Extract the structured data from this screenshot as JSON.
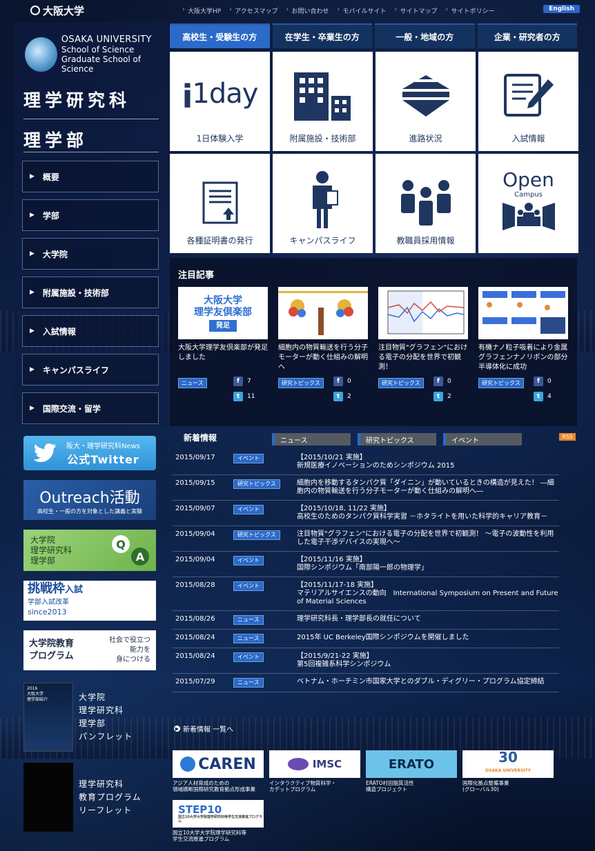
{
  "header": {
    "logo": "大阪大学",
    "links": [
      "大阪大学HP",
      "アクセスマップ",
      "お問い合わせ",
      "モバイルサイト",
      "サイトマップ",
      "サイトポリシー"
    ],
    "english": "English"
  },
  "sidebar": {
    "univ_name": "OSAKA UNIVERSITY",
    "school": "School of Science",
    "grad_school": "Graduate School of Science",
    "title1": "理学研究科",
    "title2": "理学部",
    "items": [
      "概要",
      "学部",
      "大学院",
      "附属施設・技術部",
      "入試情報",
      "キャンパスライフ",
      "国際交流・留学"
    ]
  },
  "categories": [
    "高校生・受験生の方",
    "在学生・卒業生の方",
    "一般・地域の方",
    "企業・研究者の方"
  ],
  "tiles": [
    {
      "label": "1日体験入学",
      "icon": "1day-icon",
      "text": "1day"
    },
    {
      "label": "附属施設・技術部",
      "icon": "building-icon"
    },
    {
      "label": "進路状況",
      "icon": "direction-icon"
    },
    {
      "label": "入試情報",
      "icon": "document-pen-icon"
    },
    {
      "label": "各種証明書の発行",
      "icon": "certificate-upload-icon"
    },
    {
      "label": "キャンパスライフ",
      "icon": "student-icon"
    },
    {
      "label": "教職員採用情報",
      "icon": "people-icon"
    },
    {
      "label": "",
      "icon": "open-campus-icon",
      "text": "Open",
      "sub": "Campus"
    }
  ],
  "featured": {
    "title": "注目記事",
    "items": [
      {
        "title": "大阪大学理学友倶楽部が発足しました",
        "tag": "ニュース",
        "fb": "7",
        "tw": "11",
        "img_text": "大阪大学\n理学友倶楽部",
        "img_sub": "発足"
      },
      {
        "title": "細胞内の物質輸送を行う分子モーターが動く仕組みの解明へ",
        "tag": "研究トピックス",
        "fb": "0",
        "tw": "2"
      },
      {
        "title": "注目物質\"グラフェン\"における電子の分配を世界で初観測！",
        "tag": "研究トピックス",
        "fb": "0",
        "tw": "2"
      },
      {
        "title": "有機ナノ粒子吸着により金属グラフェンナノリボンの部分半導体化に成功",
        "tag": "研究トピックス",
        "fb": "0",
        "tw": "4"
      }
    ]
  },
  "banners": {
    "twitter_top": "阪大・理学研究科News",
    "twitter_main": "公式Twitter",
    "outreach": "Outreach活動",
    "outreach_sub": "高校生・一般の方を対象とした講義と実験",
    "qa_l1": "大学院",
    "qa_l2": "理学研究科",
    "qa_l3": "理学部",
    "qa_q": "Q",
    "qa_a": "A",
    "challenge_main": "挑戦枠",
    "challenge_sub": "入試",
    "challenge_l2": "学部入試改革",
    "challenge_l3": "since2013",
    "gradedu_l1": "大学院教育",
    "gradedu_l2": "プログラム",
    "gradedu_r1": "社会で役立つ",
    "gradedu_r2": "能力を",
    "gradedu_r3": "身につける",
    "pamph_lines": [
      "大学院",
      "理学研究科",
      "理学部",
      "パンフレット"
    ],
    "pamph_cover": "2016\n大阪大学\n理学部紹介",
    "leaf_lines": [
      "理学研究科",
      "教育プログラム",
      "リーフレット"
    ]
  },
  "news": {
    "title": "新着情報",
    "tabs": [
      "ニュース",
      "研究トピックス",
      "イベント"
    ],
    "rss": "RSS",
    "rows": [
      {
        "date": "2015/09/17",
        "cat": "イベント",
        "text": "【2015/10/21 実施】\n新規医療イノベーションのためシンポジウム 2015"
      },
      {
        "date": "2015/09/15",
        "cat": "研究トピックス",
        "text": "細胞内を移動するタンパク質「ダイニン」が動いているときの構造が見えた！ ―細胞内の物質輸送を行う分子モーターが動く仕組みの解明へ―"
      },
      {
        "date": "2015/09/07",
        "cat": "イベント",
        "text": "【2015/10/18, 11/22 実施】\n高校生のためのタンパク質科学実習 －ホタライトを用いた科学的キャリア教育－"
      },
      {
        "date": "2015/09/04",
        "cat": "研究トピックス",
        "text": "注目物質\"グラフェン\"における電子の分配を世界で初観測！ ～電子の波動性を利用した電子干渉デバイスの実現へ～"
      },
      {
        "date": "2015/09/04",
        "cat": "イベント",
        "text": "【2015/11/16 実施】\n国際シンポジウム「南部陽一郎の物理学」"
      },
      {
        "date": "2015/08/28",
        "cat": "イベント",
        "text": "【2015/11/17-18 実施】\nマテリアルサイエンスの動向　International Symposium on Present and Future of Material Sciences"
      },
      {
        "date": "2015/08/26",
        "cat": "ニュース",
        "text": "理学研究科長・理学部長の就任について"
      },
      {
        "date": "2015/08/24",
        "cat": "ニュース",
        "text": "2015年 UC Berkeley国際シンポジウムを開催しました"
      },
      {
        "date": "2015/08/24",
        "cat": "イベント",
        "text": "【2015/9/21-22 実施】\n第5回複雑系科学シンポジウム"
      },
      {
        "date": "2015/07/29",
        "cat": "ニュース",
        "text": "ベトナム・ホーチミン市国家大学とのダブル・ディグリー・プログラム協定締結"
      }
    ],
    "more": "新着情報 一覧へ"
  },
  "partners": [
    {
      "name": "CAREN",
      "cap": "アジア人材育成のための\n領域横断国際研究教育拠点形成事業"
    },
    {
      "name": "IMSC",
      "cap": "インタラクティブ物質科学・\nカデットプログラム"
    },
    {
      "name": "ERATO",
      "cap": "ERATO村田脂質活性\n構造プロジェクト"
    },
    {
      "name": "30",
      "sub": "OSAKA UNIVERSITY",
      "cap": "国際化拠点整備事業\n(グローバル30)"
    },
    {
      "name": "STEP10",
      "sub": "国立10大学大学院理学研究科等学生交流推進プログラム",
      "cap": "国立10大学大学院理学研究科等\n学生交流推進プログラム"
    }
  ]
}
